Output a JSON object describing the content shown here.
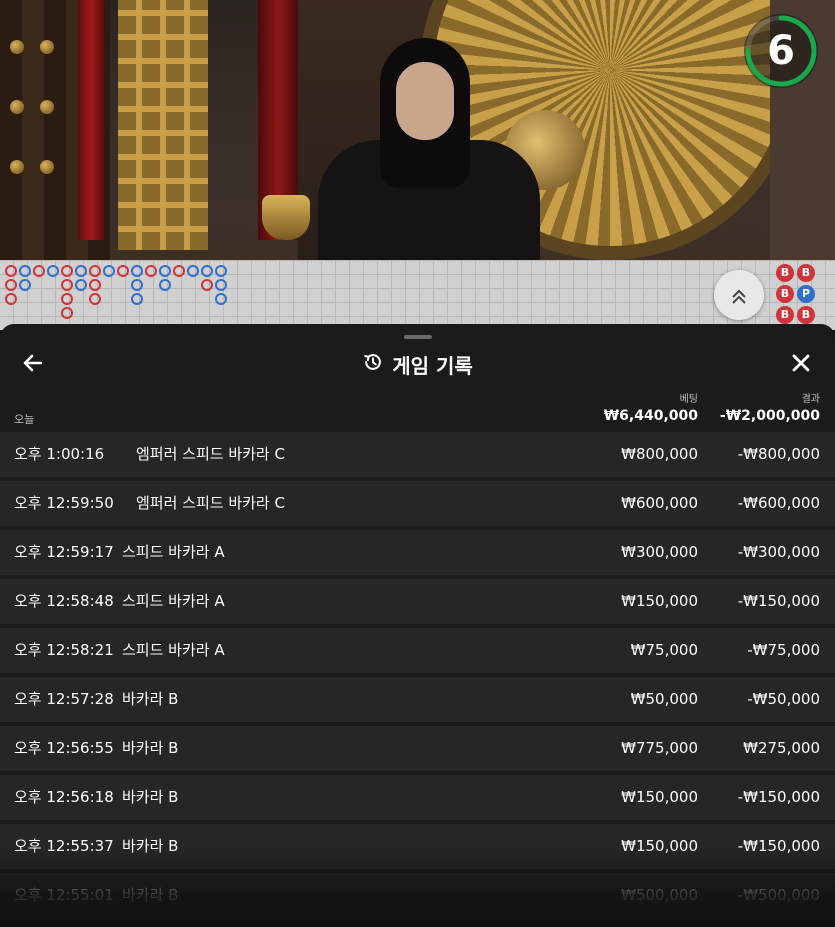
{
  "video": {
    "countdown": "6",
    "countdown_progress": 0.75,
    "countdown_color": "#19a84a"
  },
  "roadmap": {
    "banker_color": "#d0343a",
    "player_color": "#2e6fd0",
    "tie_color": "#1f9a3a",
    "beads": [
      "B",
      "B",
      "B",
      "P",
      "B",
      "B"
    ],
    "scroll_icon": "double-chevron-up-icon"
  },
  "sheet": {
    "title": "게임 기록",
    "back_icon": "arrow-left-icon",
    "history_icon": "history-clock-icon",
    "close_icon": "close-x-icon",
    "bet_header": "베팅",
    "result_header": "결과",
    "today_label": "오늘",
    "total_bet": "₩6,440,000",
    "total_result": "-₩2,000,000",
    "rows": [
      {
        "time": "오후 1:00:16",
        "game": "엠퍼러 스피드 바카라 C",
        "bet": "₩800,000",
        "result": "-₩800,000"
      },
      {
        "time": "오후 12:59:50",
        "game": "엠퍼러 스피드 바카라 C",
        "bet": "₩600,000",
        "result": "-₩600,000"
      },
      {
        "time": "오후 12:59:17",
        "game": "스피드 바카라 A",
        "bet": "₩300,000",
        "result": "-₩300,000"
      },
      {
        "time": "오후 12:58:48",
        "game": "스피드 바카라 A",
        "bet": "₩150,000",
        "result": "-₩150,000"
      },
      {
        "time": "오후 12:58:21",
        "game": "스피드 바카라 A",
        "bet": "₩75,000",
        "result": "-₩75,000"
      },
      {
        "time": "오후 12:57:28",
        "game": "바카라 B",
        "bet": "₩50,000",
        "result": "-₩50,000"
      },
      {
        "time": "오후 12:56:55",
        "game": "바카라 B",
        "bet": "₩775,000",
        "result": "₩275,000"
      },
      {
        "time": "오후 12:56:18",
        "game": "바카라 B",
        "bet": "₩150,000",
        "result": "-₩150,000"
      },
      {
        "time": "오후 12:55:37",
        "game": "바카라 B",
        "bet": "₩150,000",
        "result": "-₩150,000"
      },
      {
        "time": "오후 12:55:01",
        "game": "바카라 B",
        "bet": "₩500,000",
        "result": "-₩500,000"
      }
    ]
  }
}
